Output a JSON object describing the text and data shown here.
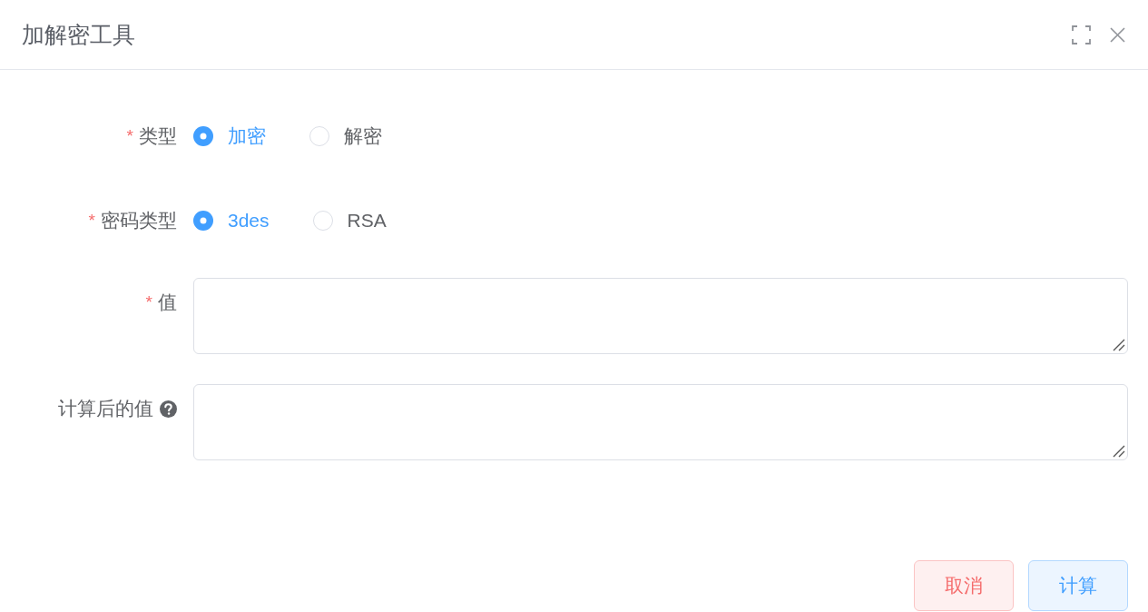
{
  "dialog": {
    "title": "加解密工具"
  },
  "form": {
    "fields": [
      {
        "kind": "radio",
        "required_mark": "*",
        "label": "类型",
        "options": [
          {
            "label": "加密",
            "selected": true
          },
          {
            "label": "解密",
            "selected": false
          }
        ]
      },
      {
        "kind": "radio",
        "required_mark": "*",
        "label": "密码类型",
        "options": [
          {
            "label": "3des",
            "selected": true
          },
          {
            "label": "RSA",
            "selected": false
          }
        ]
      },
      {
        "kind": "textarea",
        "required_mark": "*",
        "label": "值",
        "help": false
      },
      {
        "kind": "textarea",
        "label": "计算后的值",
        "help": true
      }
    ]
  },
  "buttons": [
    {
      "label": "取消",
      "kind": "danger"
    },
    {
      "label": "计算",
      "kind": "primary"
    }
  ]
}
